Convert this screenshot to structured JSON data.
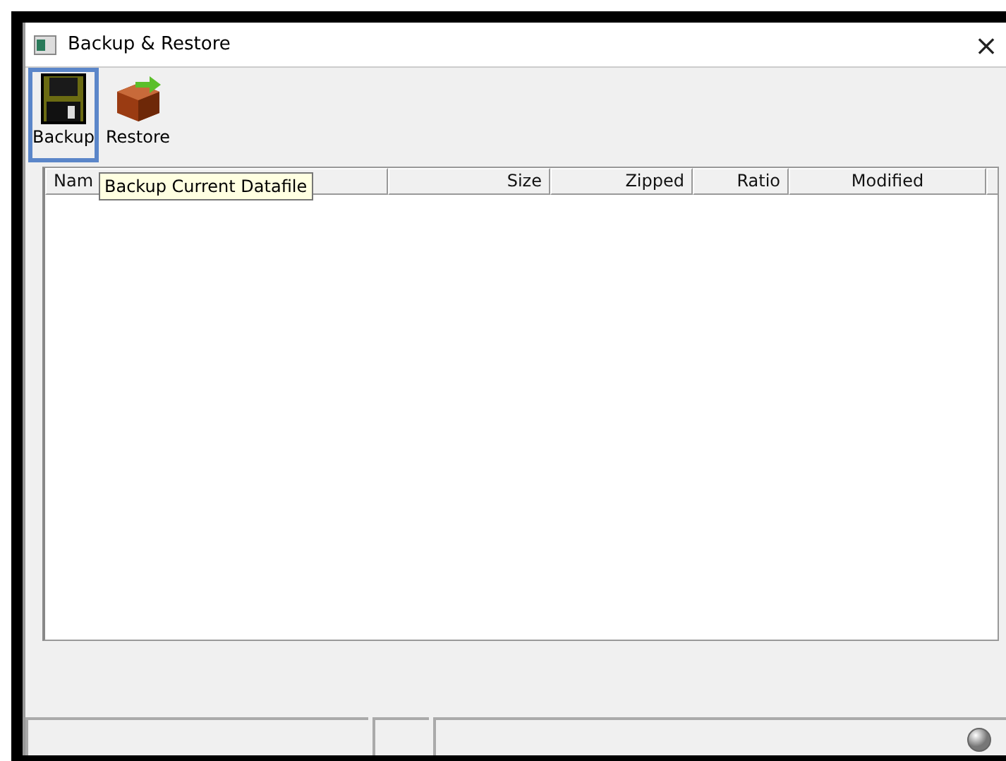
{
  "window": {
    "title": "Backup & Restore",
    "close": "×"
  },
  "toolbar": [
    {
      "label": "Backup",
      "kind": "disk",
      "selected": true
    },
    {
      "label": "Restore",
      "kind": "box",
      "selected": false
    }
  ],
  "tooltip": "Backup Current Datafile",
  "table": {
    "columns": [
      {
        "label": "Nam"
      },
      {
        "label": "Size"
      },
      {
        "label": "Zipped"
      },
      {
        "label": "Ratio"
      },
      {
        "label": "Modified"
      }
    ]
  }
}
